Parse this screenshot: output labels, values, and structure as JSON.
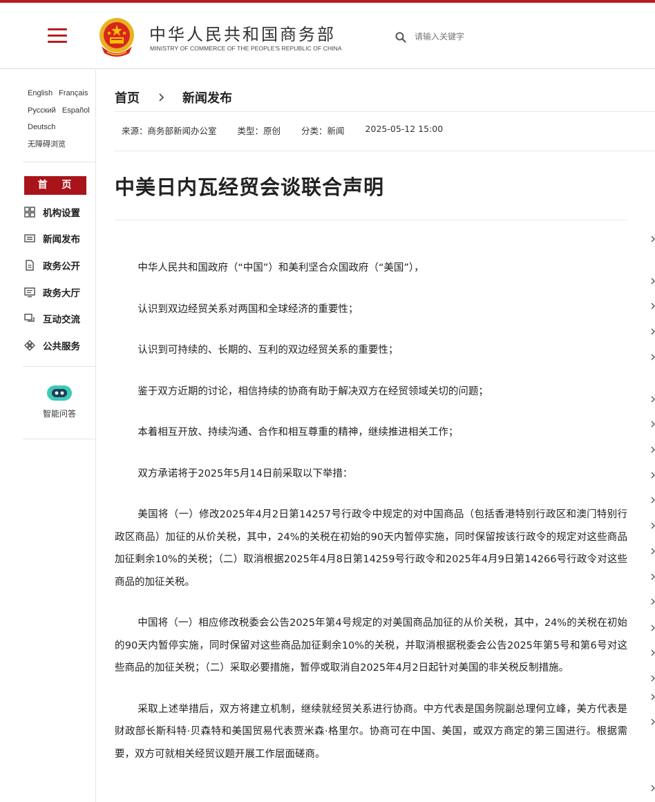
{
  "header": {
    "site_title": "中华人民共和国商务部",
    "site_subtitle": "MINISTRY OF COMMERCE OF THE PEOPLE'S REPUBLIC OF CHINA",
    "search_placeholder": "请输入关键字",
    "brand_color": "#b81c22"
  },
  "sidebar": {
    "languages": [
      [
        "English",
        "Français"
      ],
      [
        "Русский",
        "Español"
      ],
      [
        "Deutsch"
      ],
      [
        "无障碍浏览"
      ]
    ],
    "home_label": "首 页",
    "nav": [
      {
        "label": "机构设置",
        "icon": "org-grid-icon"
      },
      {
        "label": "新闻发布",
        "icon": "news-icon"
      },
      {
        "label": "政务公开",
        "icon": "document-icon"
      },
      {
        "label": "政务大厅",
        "icon": "monitor-icon"
      },
      {
        "label": "互动交流",
        "icon": "chat-icon"
      },
      {
        "label": "公共服务",
        "icon": "service-icon"
      }
    ],
    "assistant_label": "智能问答"
  },
  "breadcrumb": {
    "home": "首页",
    "current": "新闻发布"
  },
  "meta": {
    "source": "来源：商务部新闻办公室",
    "type": "类型：原创",
    "category": "分类：新闻",
    "datetime": "2025-05-12 15:00"
  },
  "article": {
    "title": "中美日内瓦经贸会谈联合声明",
    "paragraphs": [
      "中华人民共和国政府（“中国”）和美利坚合众国政府（“美国”），",
      "认识到双边经贸关系对两国和全球经济的重要性；",
      "认识到可持续的、长期的、互利的双边经贸关系的重要性；",
      "鉴于双方近期的讨论，相信持续的协商有助于解决双方在经贸领域关切的问题；",
      "本着相互开放、持续沟通、合作和相互尊重的精神，继续推进相关工作；",
      "双方承诺将于2025年5月14日前采取以下举措：",
      "美国将（一）修改2025年4月2日第14257号行政令中规定的对中国商品（包括香港特别行政区和澳门特别行政区商品）加征的从价关税，其中，24%的关税在初始的90天内暂停实施，同时保留按该行政令的规定对这些商品加征剩余10%的关税；（二）取消根据2025年4月8日第14259号行政令和2025年4月9日第14266号行政令对这些商品的加征关税。",
      "中国将（一）相应修改税委会公告2025年第4号规定的对美国商品加征的从价关税，其中，24%的关税在初始的90天内暂停实施，同时保留对这些商品加征剩余10%的关税，并取消根据税委会公告2025年第5号和第6号对这些商品的加征关税；（二）采取必要措施，暂停或取消自2025年4月2日起针对美国的非关税反制措施。",
      "采取上述举措后，双方将建立机制，继续就经贸关系进行协商。中方代表是国务院副总理何立峰，美方代表是财政部长斯科特·贝森特和美国贸易代表贾米森·格里尔。协商可在中国、美国，或双方商定的第三国进行。根据需要，双方可就相关经贸议题开展工作层面磋商。"
    ]
  }
}
